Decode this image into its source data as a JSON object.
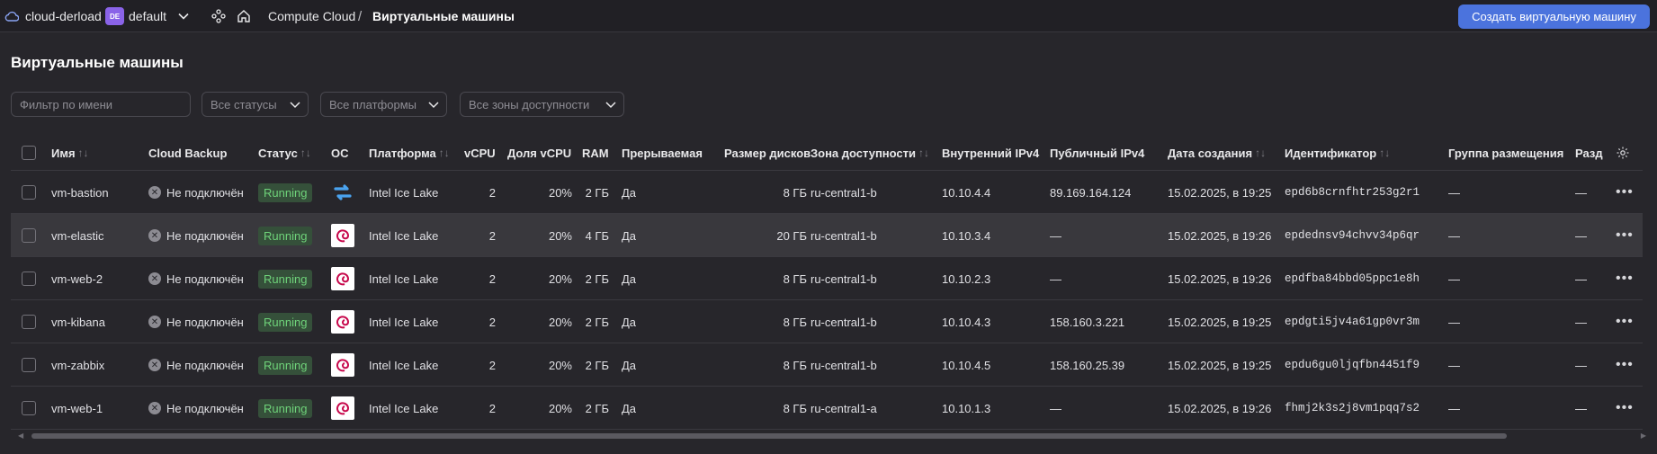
{
  "header": {
    "cloud_name": "cloud-derload",
    "folder_badge": "DE",
    "folder_name": "default",
    "breadcrumb_service": "Compute Cloud",
    "breadcrumb_sep": "/",
    "breadcrumb_page": "Виртуальные машины",
    "create_button": "Создать виртуальную машину"
  },
  "page": {
    "title": "Виртуальные машины"
  },
  "filters": {
    "name_placeholder": "Фильтр по имени",
    "status": "Все статусы",
    "platform": "Все платформы",
    "zone": "Все зоны доступности"
  },
  "columns": {
    "name": "Имя",
    "backup": "Cloud Backup",
    "status": "Статус",
    "os": "ОС",
    "platform": "Платформа",
    "vcpu": "vCPU",
    "vcpu_share": "Доля vCPU",
    "ram": "RAM",
    "preemptible": "Прерываемая",
    "disk_size": "Размер дисков",
    "zone": "Зона доступности",
    "ipv4_internal": "Внутренний IPv4",
    "ipv4_public": "Публичный IPv4",
    "created": "Дата создания",
    "id": "Идентификатор",
    "placement_group": "Группа размещения",
    "divider": "Разд",
    "sort_glyph": "↑↓"
  },
  "rows": [
    {
      "name": "vm-bastion",
      "backup": "Не подключён",
      "status": "Running",
      "os": "ubuntu-icon",
      "platform": "Intel Ice Lake",
      "vcpu": "2",
      "share": "20%",
      "ram": "2 ГБ",
      "preempt": "Да",
      "disk": "8 ГБ",
      "zone": "ru-central1-b",
      "ip_in": "10.10.4.4",
      "ip_pub": "89.169.164.124",
      "created": "15.02.2025, в 19:25",
      "id": "epd6b8crnfhtr253g2r1",
      "group": "—",
      "div": "—"
    },
    {
      "name": "vm-elastic",
      "backup": "Не подключён",
      "status": "Running",
      "os": "debian-icon",
      "platform": "Intel Ice Lake",
      "vcpu": "2",
      "share": "20%",
      "ram": "4 ГБ",
      "preempt": "Да",
      "disk": "20 ГБ",
      "zone": "ru-central1-b",
      "ip_in": "10.10.3.4",
      "ip_pub": "—",
      "created": "15.02.2025, в 19:26",
      "id": "epdednsv94chvv34p6qr",
      "group": "—",
      "div": "—"
    },
    {
      "name": "vm-web-2",
      "backup": "Не подключён",
      "status": "Running",
      "os": "debian-icon",
      "platform": "Intel Ice Lake",
      "vcpu": "2",
      "share": "20%",
      "ram": "2 ГБ",
      "preempt": "Да",
      "disk": "8 ГБ",
      "zone": "ru-central1-b",
      "ip_in": "10.10.2.3",
      "ip_pub": "—",
      "created": "15.02.2025, в 19:26",
      "id": "epdfba84bbd05ppc1e8h",
      "group": "—",
      "div": "—"
    },
    {
      "name": "vm-kibana",
      "backup": "Не подключён",
      "status": "Running",
      "os": "debian-icon",
      "platform": "Intel Ice Lake",
      "vcpu": "2",
      "share": "20%",
      "ram": "2 ГБ",
      "preempt": "Да",
      "disk": "8 ГБ",
      "zone": "ru-central1-b",
      "ip_in": "10.10.4.3",
      "ip_pub": "158.160.3.221",
      "created": "15.02.2025, в 19:25",
      "id": "epdgti5jv4a61gp0vr3m",
      "group": "—",
      "div": "—"
    },
    {
      "name": "vm-zabbix",
      "backup": "Не подключён",
      "status": "Running",
      "os": "debian-icon",
      "platform": "Intel Ice Lake",
      "vcpu": "2",
      "share": "20%",
      "ram": "2 ГБ",
      "preempt": "Да",
      "disk": "8 ГБ",
      "zone": "ru-central1-b",
      "ip_in": "10.10.4.5",
      "ip_pub": "158.160.25.39",
      "created": "15.02.2025, в 19:25",
      "id": "epdu6gu0ljqfbn4451f9",
      "group": "—",
      "div": "—"
    },
    {
      "name": "vm-web-1",
      "backup": "Не подключён",
      "status": "Running",
      "os": "debian-icon",
      "platform": "Intel Ice Lake",
      "vcpu": "2",
      "share": "20%",
      "ram": "2 ГБ",
      "preempt": "Да",
      "disk": "8 ГБ",
      "zone": "ru-central1-a",
      "ip_in": "10.10.1.3",
      "ip_pub": "—",
      "created": "15.02.2025, в 19:26",
      "id": "fhmj2k3s2j8vm1pqq7s2",
      "group": "—",
      "div": "—"
    }
  ],
  "colors": {
    "accent": "#4b73dd",
    "running_bg": "#35503a",
    "running_text": "#6fd37a",
    "folder_badge": "#8a63e8"
  }
}
